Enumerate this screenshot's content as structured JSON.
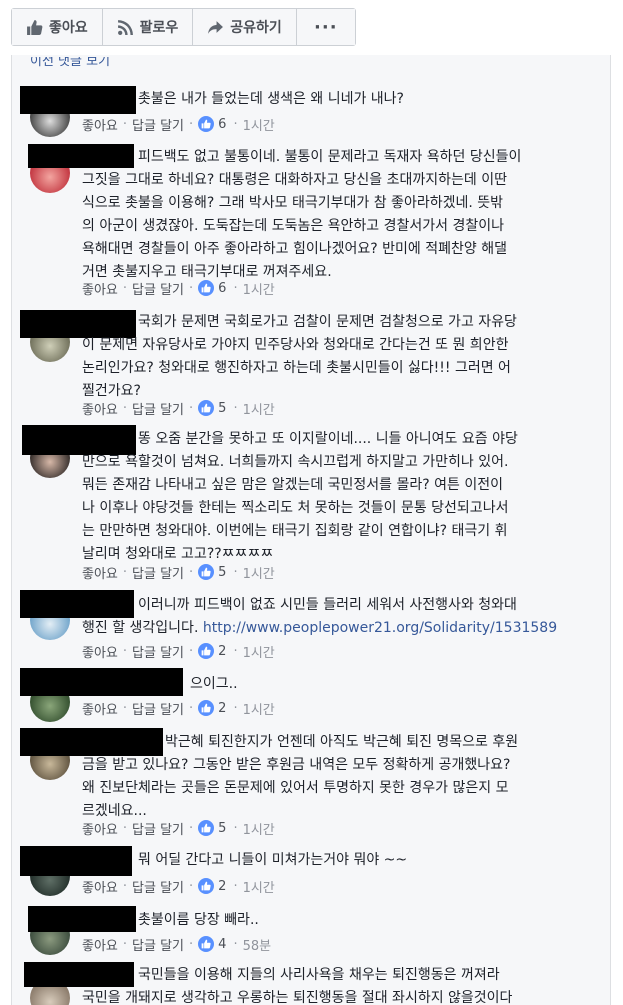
{
  "actions": {
    "like": "좋아요",
    "follow": "팔로우",
    "share": "공유하기",
    "more": "···"
  },
  "prev_comments_link": "이전 댓글 보기",
  "meta_labels": {
    "like": "좋아요",
    "reply": "답글 달기"
  },
  "colors": {
    "link": "#365899",
    "like_blue": "#5890ff",
    "panel": "#f6f7f9",
    "censor": "#000000"
  },
  "comments": [
    {
      "lines": [
        "촛불은 내가 들었는데 생색은 왜 니네가 내나?"
      ],
      "likes": "6",
      "time": "1시간"
    },
    {
      "lines": [
        "피드백도 없고 불통이네. 불통이 문제라고 독재자 욕하던 당신들이",
        "그짓을 그대로 하네요? 대통령은 대화하자고 당신을 초대까지하는데 이딴",
        "식으로 촛불을 이용해? 그래 박사모 태극기부대가 참 좋아라하겠네. 뜻밖",
        "의 아군이 생겼잖아. 도둑잡는데 도둑놈은 욕안하고 경찰서가서 경찰이나",
        "욕해대면 경찰들이 아주 좋아라하고 힘이나겠어요? 반미에 적폐찬양 해댈",
        "거면 촛불지우고 태극기부대로 꺼져주세요."
      ],
      "likes": "6",
      "time": "1시간"
    },
    {
      "lines": [
        "국회가 문제면 국회로가고 검찰이 문제면 검찰청으로 가고 자유당",
        "이 문제면 자유당사로 가야지 민주당사와 청와대로 간다는건 또 뭔 희안한",
        "논리인가요? 청와대로 행진하자고 하는데 촛불시민들이 싫다!!! 그러면 어",
        "찔건가요?"
      ],
      "likes": "5",
      "time": "1시간"
    },
    {
      "lines": [
        "똥 오줌 분간을 못하고 또 이지랄이네.... 니들 아니여도 요즘 야당",
        "만으로 욕할것이 넘쳐요. 너희들까지 속시끄럽게 하지말고 가만히나 있어.",
        "뭐든 존재감 나타내고 싶은 맘은 알겠는데 국민정서를 몰라? 여튼 이전이",
        "나 이후나 야당것들 한테는 찍소리도 처 못하는 것들이 문통 당선되고나서",
        "는 만만하면 청와대야. 이번에는 태극기 집회랑 같이 연합이냐? 태극기 휘",
        "날리며 청와대로 고고??ㅉㅉㅉㅉ"
      ],
      "likes": "5",
      "time": "1시간"
    },
    {
      "lines": [
        "이러니까 피드백이 없죠 시민들 들러리 세워서 사전행사와 청와대",
        "행진 할 생각입니다."
      ],
      "link": "http://www.peoplepower21.org/Solidarity/1531589",
      "likes": "2",
      "time": "1시간"
    },
    {
      "lines": [
        "으이그.."
      ],
      "likes": "2",
      "time": "1시간"
    },
    {
      "lines": [
        "박근혜 퇴진한지가 언젠데 아직도 박근혜 퇴진 명목으로 후원",
        "금을 받고 있나요? 그동안 받은 후원금 내역은 모두 정확하게 공개했나요?",
        "왜 진보단체라는 곳들은 돈문제에 있어서 투명하지 못한 경우가 많은지 모",
        "르겠네요..."
      ],
      "likes": "5",
      "time": "1시간"
    },
    {
      "lines": [
        "뭐 어딜 간다고 니들이 미쳐가는거야 뭐야 ~~"
      ],
      "likes": "2",
      "time": "1시간"
    },
    {
      "lines": [
        "촛불이름 당장 빼라.."
      ],
      "likes": "4",
      "time": "58분"
    },
    {
      "lines": [
        "국민들을 이용해 지들의 사리사욕을 채우는 퇴진행동은 꺼져라",
        "국민을 개돼지로 생각하고 우롱하는 퇴진행동을 절대 좌시하지 않을것이다"
      ]
    }
  ]
}
